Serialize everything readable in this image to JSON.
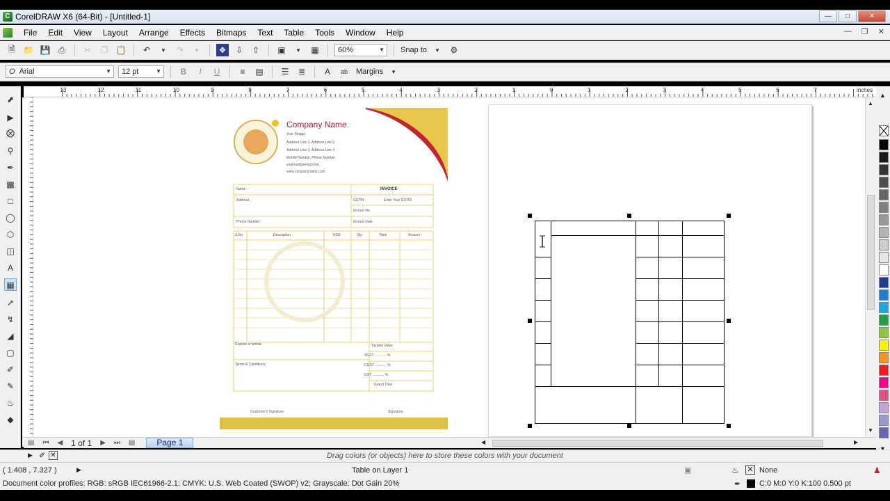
{
  "window": {
    "title": "CorelDRAW X6 (64-Bit) - [Untitled-1]"
  },
  "menu": [
    "File",
    "Edit",
    "View",
    "Layout",
    "Arrange",
    "Effects",
    "Bitmaps",
    "Text",
    "Table",
    "Tools",
    "Window",
    "Help"
  ],
  "standard_toolbar": {
    "zoom": "60%",
    "snap_to": "Snap to"
  },
  "property_bar": {
    "font": "Arial",
    "size": "12 pt",
    "margins": "Margins"
  },
  "ruler": {
    "unit": "inches",
    "labels": [
      "13",
      "12",
      "11",
      "10",
      "9",
      "8",
      "7",
      "6",
      "5",
      "4",
      "3",
      "2",
      "1",
      "0",
      "1",
      "2",
      "3",
      "4",
      "5",
      "6",
      "7"
    ]
  },
  "invoice": {
    "company": "Company Name",
    "slogan": "Your Slogan",
    "address_lines": [
      "Address Line 1, Address Line 2",
      "Address Line 3, Address Line 4",
      "Mobile Number, Phone Number",
      "yourmail@email.com",
      "www.companyname.com"
    ],
    "invoice_label": "INVOICE",
    "name_label": "Name :",
    "address_label": "Address :",
    "phone_label": "Phone Number:",
    "gstin_label": "GSTIN",
    "gstin_value": "Enter Your GSTIN",
    "invoice_no": "Invoice No.",
    "invoice_date": "Invoice Date",
    "columns": [
      "S.No",
      "Description",
      "HSN",
      "Qty",
      "Rate",
      "Amount"
    ],
    "rupees": "Rupees in words :",
    "terms": "Terms & Conditions :",
    "totals": [
      "Taxable Value",
      "SGST ............ %",
      "CGST ............ %",
      "GST ............ %",
      "Grand Total"
    ],
    "customer_sig": "Customer's Signature",
    "signature": "Signature"
  },
  "pages": {
    "counter": "1 of 1",
    "tab": "Page 1"
  },
  "hint": "Drag colors (or objects) here to store these colors with your document",
  "status": {
    "coords": "( 1.408 , 7.327 )",
    "object": "Table on Layer 1",
    "fill": "None",
    "outline": "C:0 M:0 Y:0 K:100  0.500 pt",
    "profile": "Document color profiles: RGB: sRGB IEC61966-2.1; CMYK: U.S. Web Coated (SWOP) v2; Grayscale: Dot Gain 20%"
  },
  "colors": {
    "accent_red": "#c0262d",
    "accent_yellow": "#e8c84a",
    "palette": [
      "#000000",
      "#1a1a1a",
      "#333333",
      "#4d4d4d",
      "#666666",
      "#808080",
      "#999999",
      "#b3b3b3",
      "#cccccc",
      "#e6e6e6",
      "#ffffff",
      "#1f3d8c",
      "#1e7fd9",
      "#1aa8e0",
      "#1fa34a",
      "#8cc63f",
      "#fff200",
      "#f7941d",
      "#ed1c24",
      "#ec008c",
      "#e0508c",
      "#c2a3d6",
      "#9999cc",
      "#6666b3"
    ]
  }
}
